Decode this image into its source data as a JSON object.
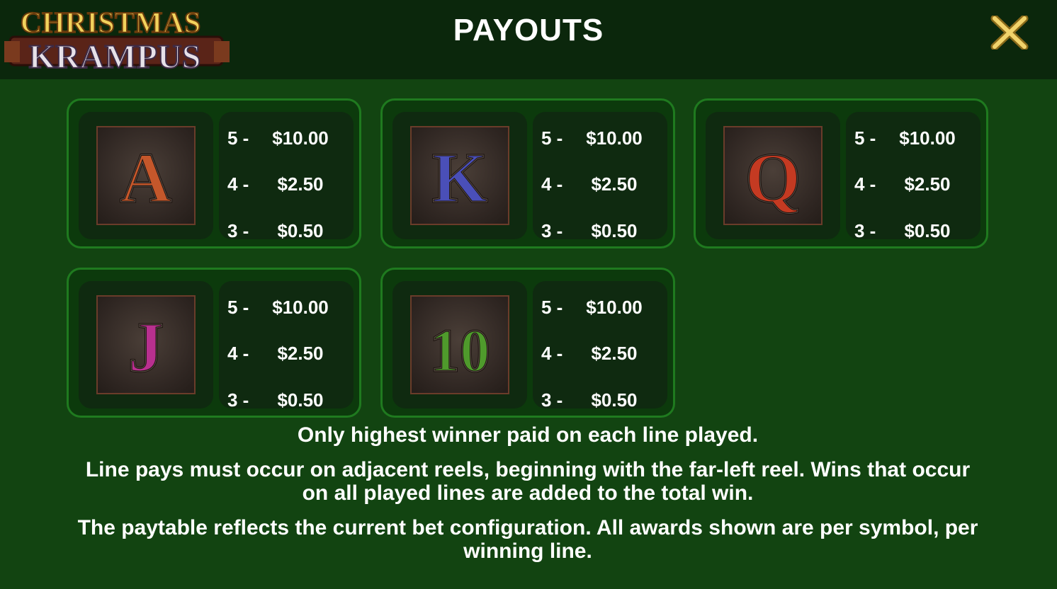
{
  "header": {
    "logo_line1": "CHRISTMAS",
    "logo_line2": "KRAMPUS",
    "title": "PAYOUTS",
    "close_icon": "close-x-icon"
  },
  "colors": {
    "background": "#124411",
    "topbar": "#0b270c",
    "card_border": "#1f7a1f",
    "close_gold": "#e8c65a"
  },
  "paytable": [
    {
      "symbol": "A",
      "color": "#c4572b",
      "rows": [
        {
          "count": "5 -",
          "amount": "$10.00"
        },
        {
          "count": "4 -",
          "amount": "$2.50"
        },
        {
          "count": "3 -",
          "amount": "$0.50"
        }
      ]
    },
    {
      "symbol": "K",
      "color": "#4a4fb8",
      "rows": [
        {
          "count": "5 -",
          "amount": "$10.00"
        },
        {
          "count": "4 -",
          "amount": "$2.50"
        },
        {
          "count": "3 -",
          "amount": "$0.50"
        }
      ]
    },
    {
      "symbol": "Q",
      "color": "#c43a22",
      "rows": [
        {
          "count": "5 -",
          "amount": "$10.00"
        },
        {
          "count": "4 -",
          "amount": "$2.50"
        },
        {
          "count": "3 -",
          "amount": "$0.50"
        }
      ]
    },
    {
      "symbol": "J",
      "color": "#b8308f",
      "rows": [
        {
          "count": "5 -",
          "amount": "$10.00"
        },
        {
          "count": "4 -",
          "amount": "$2.50"
        },
        {
          "count": "3 -",
          "amount": "$0.50"
        }
      ]
    },
    {
      "symbol": "10",
      "color": "#4f9a2c",
      "rows": [
        {
          "count": "5 -",
          "amount": "$10.00"
        },
        {
          "count": "4 -",
          "amount": "$2.50"
        },
        {
          "count": "3 -",
          "amount": "$0.50"
        }
      ]
    }
  ],
  "notes": [
    "Only highest winner paid on each line played.",
    "Line pays must occur on adjacent reels, beginning with the far-left reel. Wins that occur on all played lines are added to the total win.",
    "The paytable reflects the current bet configuration. All awards shown are per symbol, per winning line."
  ]
}
